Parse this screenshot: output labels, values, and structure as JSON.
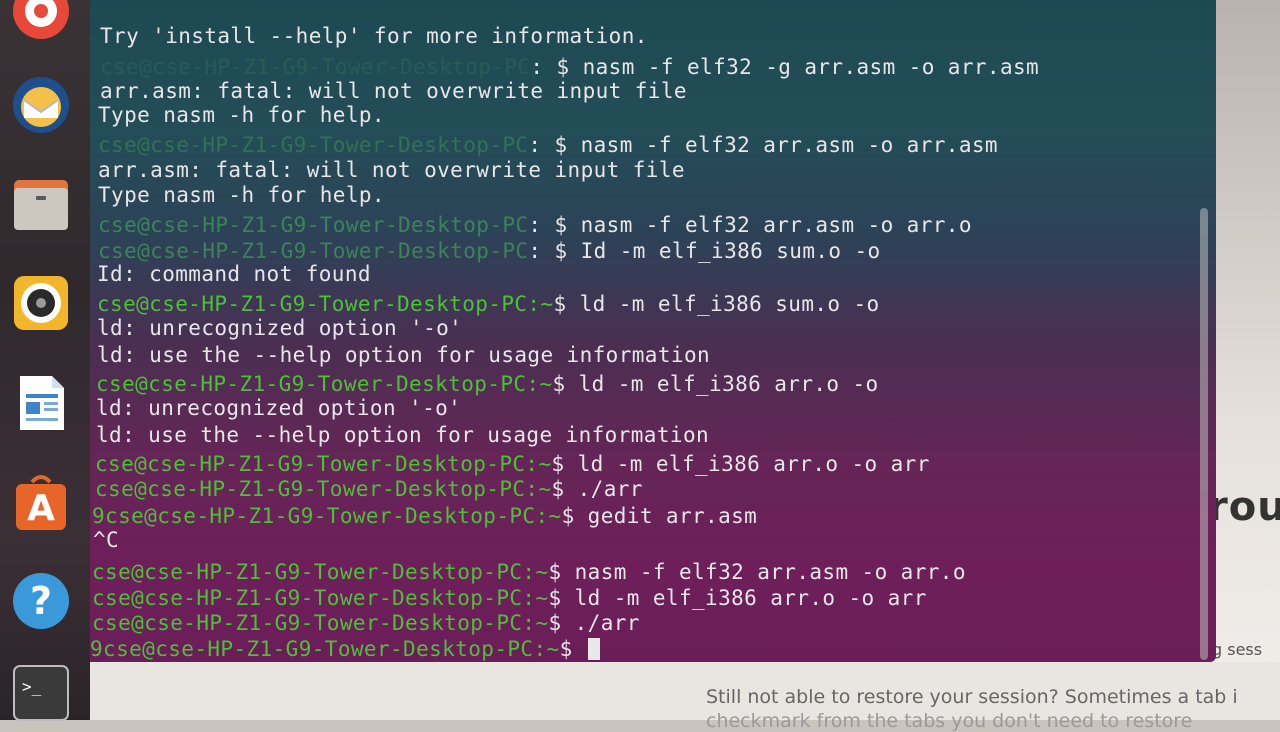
{
  "dock": {
    "items": [
      {
        "icon": "rhythmbox-icon"
      },
      {
        "icon": "thunderbird-icon"
      },
      {
        "icon": "files-icon"
      },
      {
        "icon": "rhythmbox-speaker-icon"
      },
      {
        "icon": "libreoffice-writer-icon"
      },
      {
        "icon": "software-center-icon"
      },
      {
        "icon": "help-icon"
      },
      {
        "icon": "terminal-icon"
      }
    ]
  },
  "terminal": {
    "line1": "Try 'install --help' for more information.",
    "line2_prompt": "cse@cse-HP-Z1-G9-Tower-Desktop-PC",
    "line2_cmd": ": $ nasm -f elf32 -g arr.asm -o arr.asm",
    "line3": "arr.asm: fatal: will not overwrite input file",
    "line4": "Type nasm -h for help.",
    "line5_prompt": "cse@cse-HP-Z1-G9-Tower-Desktop-PC",
    "line5_cmd": ": $ nasm -f elf32 arr.asm -o arr.asm",
    "line6": "arr.asm: fatal: will not overwrite input file",
    "line7": "Type nasm -h for help.",
    "line8_prompt": "cse@cse-HP-Z1-G9-Tower-Desktop-PC",
    "line8_cmd": ": $ nasm -f elf32 arr.asm -o arr.o",
    "line9_prompt": "cse@cse-HP-Z1-G9-Tower-Desktop-PC",
    "line9_cmd": ": $ Id -m elf_i386 sum.o -o",
    "line10": "Id: command not found",
    "line11_prompt": "cse@cse-HP-Z1-G9-Tower-Desktop-PC:~",
    "line11_cmd": "$ ld -m elf_i386 sum.o -o",
    "line12": "ld: unrecognized option '-o'",
    "line13": "ld: use the --help option for usage information",
    "line14_prompt": "cse@cse-HP-Z1-G9-Tower-Desktop-PC:~",
    "line14_cmd": "$ ld -m elf_i386 arr.o -o",
    "line15": "ld: unrecognized option '-o'",
    "line16": "ld: use the --help option for usage information",
    "line17_prompt": "cse@cse-HP-Z1-G9-Tower-Desktop-PC:~",
    "line17_cmd": "$ ld -m elf_i386 arr.o -o arr",
    "line18_prompt": "cse@cse-HP-Z1-G9-Tower-Desktop-PC:~",
    "line18_cmd": "$ ./arr",
    "line19_prompt": "9cse@cse-HP-Z1-G9-Tower-Desktop-PC:~",
    "line19_cmd": "$ gedit arr.asm",
    "line20": "^C",
    "line21_prompt": "cse@cse-HP-Z1-G9-Tower-Desktop-PC:~",
    "line21_cmd": "$ nasm -f elf32 arr.asm -o arr.o",
    "line22_prompt": "cse@cse-HP-Z1-G9-Tower-Desktop-PC:~",
    "line22_cmd": "$ ld -m elf_i386 arr.o -o arr",
    "line23_prompt": "cse@cse-HP-Z1-G9-Tower-Desktop-PC:~",
    "line23_cmd": "$ ./arr",
    "line24_prompt": "9cse@cse-HP-Z1-G9-Tower-Desktop-PC:~",
    "line24_cmd": "$ "
  },
  "background": {
    "big_text": "rou",
    "small_text": "g sess",
    "restore_text": "Still not able to restore your session? Sometimes a tab i",
    "restore_text2": "checkmark from the tabs you don't need to restore"
  },
  "colors": {
    "prompt_green": "#4fbf3a",
    "terminal_text": "#e9e6ea",
    "terminal_bg_top": "#1d4a52",
    "terminal_bg_bottom": "#6a1e58"
  }
}
